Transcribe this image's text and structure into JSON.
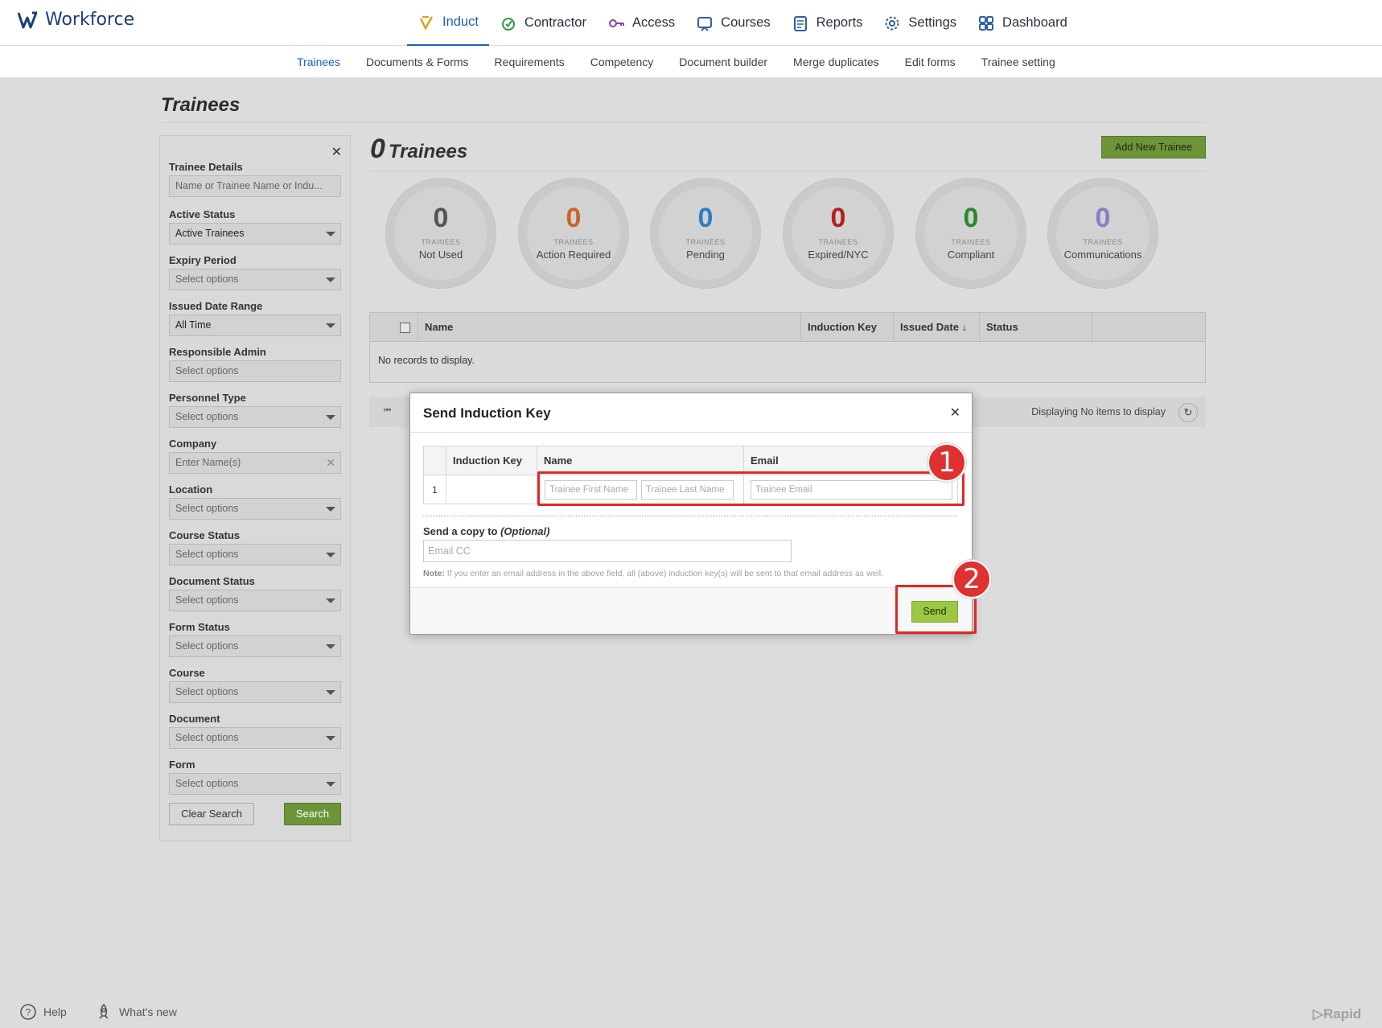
{
  "app": {
    "name": "Workforce"
  },
  "main_nav": [
    {
      "label": "Induct",
      "icon": "induct-icon",
      "active": true
    },
    {
      "label": "Contractor",
      "icon": "contractor-icon"
    },
    {
      "label": "Access",
      "icon": "key-icon"
    },
    {
      "label": "Courses",
      "icon": "courses-icon"
    },
    {
      "label": "Reports",
      "icon": "reports-icon"
    },
    {
      "label": "Settings",
      "icon": "gear-icon"
    },
    {
      "label": "Dashboard",
      "icon": "dashboard-icon"
    }
  ],
  "sub_nav": [
    "Trainees",
    "Documents & Forms",
    "Requirements",
    "Competency",
    "Document builder",
    "Merge duplicates",
    "Edit forms",
    "Trainee setting"
  ],
  "page_title": "Trainees",
  "filters": {
    "trainee_details": {
      "label": "Trainee Details",
      "placeholder": "Name or Trainee Name or Indu..."
    },
    "active_status": {
      "label": "Active Status",
      "value": "Active Trainees"
    },
    "expiry_period": {
      "label": "Expiry Period",
      "value": "Select options"
    },
    "issued_date_range": {
      "label": "Issued Date Range",
      "value": "All Time"
    },
    "responsible_admin": {
      "label": "Responsible Admin",
      "value": "Select options"
    },
    "personnel_type": {
      "label": "Personnel Type",
      "value": "Select options"
    },
    "company": {
      "label": "Company",
      "value": "Enter Name(s)"
    },
    "location": {
      "label": "Location",
      "value": "Select options"
    },
    "course_status": {
      "label": "Course Status",
      "value": "Select options"
    },
    "document_status": {
      "label": "Document Status",
      "value": "Select options"
    },
    "form_status": {
      "label": "Form Status",
      "value": "Select options"
    },
    "course": {
      "label": "Course",
      "value": "Select options"
    },
    "document": {
      "label": "Document",
      "value": "Select options"
    },
    "form": {
      "label": "Form",
      "value": "Select options"
    },
    "clear_label": "Clear Search",
    "search_label": "Search"
  },
  "summary": {
    "count": "0",
    "label": "Trainees",
    "add_label": "Add New Trainee"
  },
  "stats": [
    {
      "value": "0",
      "sublabel": "TRAINEES",
      "label": "Not Used",
      "color": "#555555"
    },
    {
      "value": "0",
      "sublabel": "TRAINEES",
      "label": "Action Required",
      "color": "#c9652a"
    },
    {
      "value": "0",
      "sublabel": "TRAINEES",
      "label": "Pending",
      "color": "#2b7fc4"
    },
    {
      "value": "0",
      "sublabel": "TRAINEES",
      "label": "Expired/NYC",
      "color": "#b41f1f"
    },
    {
      "value": "0",
      "sublabel": "TRAINEES",
      "label": "Compliant",
      "color": "#2a8a2a"
    },
    {
      "value": "0",
      "sublabel": "TRAINEES",
      "label": "Communications",
      "color": "#8e7cc3"
    }
  ],
  "grid": {
    "columns": [
      "Name",
      "Induction Key",
      "Issued Date ↓",
      "Status"
    ],
    "empty": "No records to display.",
    "pager_text": "Displaying No items to display"
  },
  "modal": {
    "title": "Send Induction Key",
    "columns": [
      "Induction Key",
      "Name",
      "Email"
    ],
    "row_num": "1",
    "first_name_ph": "Trainee First Name",
    "last_name_ph": "Trainee Last Name",
    "email_ph": "Trainee Email",
    "cc_label": "Send a copy to ",
    "cc_optional": "(Optional)",
    "cc_ph": "Email CC",
    "note_label": "Note:",
    "note_text": " If you enter an email address in the above field, all (above) induction key(s) will be sent to that email address as well.",
    "send_label": "Send"
  },
  "annotations": [
    "1",
    "2"
  ],
  "footer": {
    "help": "Help",
    "whats_new": "What's new",
    "brand": "Rapid"
  }
}
